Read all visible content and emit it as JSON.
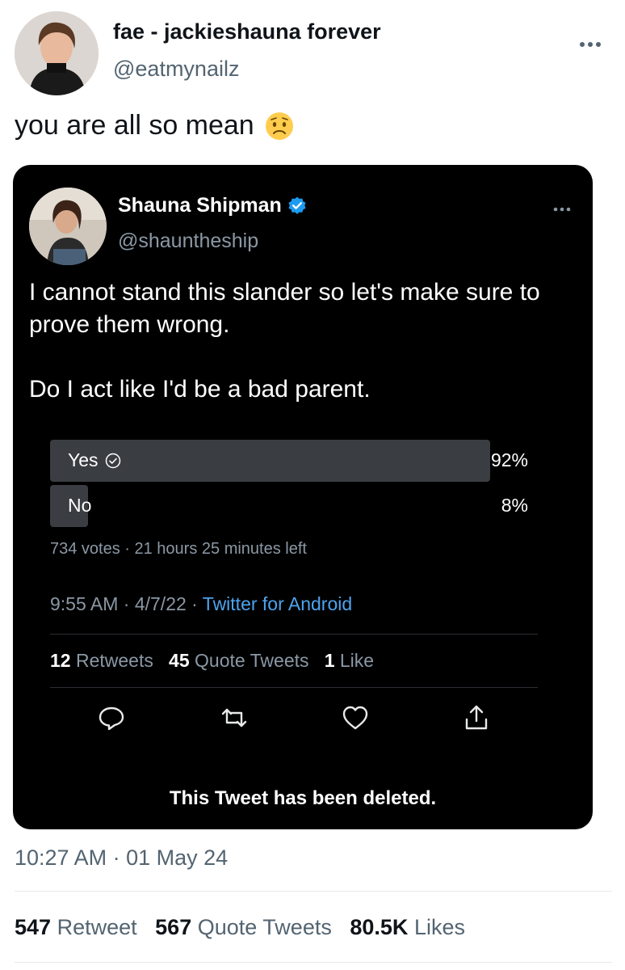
{
  "outer_tweet": {
    "display_name": "fae - jackieshauna forever",
    "handle": "@eatmynailz",
    "text": "you are all so mean",
    "emoji_icon": "worried-face-emoji",
    "timestamp": "10:27 AM · 01 May 24",
    "stats": {
      "retweets_count": "547",
      "retweets_label": "Retweet",
      "quote_count": "567",
      "quote_label": "Quote Tweets",
      "likes_count": "80.5K",
      "likes_label": "Likes"
    }
  },
  "embedded_tweet": {
    "display_name": "Shauna Shipman",
    "verified": true,
    "handle": "@shauntheship",
    "text_line1": "I cannot stand this slander so let's make sure to prove them wrong.",
    "text_line2": "Do I act like I'd be a bad parent.",
    "poll": {
      "options": [
        {
          "label": "Yes",
          "percent_label": "92%",
          "percent": 92,
          "selected": true
        },
        {
          "label": "No",
          "percent_label": "8%",
          "percent": 8,
          "selected": false
        }
      ],
      "meta": "734 votes · 21 hours 25 minutes left"
    },
    "time_prefix": "9:55 AM · 4/7/22 · ",
    "source": "Twitter for Android",
    "stats": {
      "retweets_count": "12",
      "retweets_label": "Retweets",
      "quote_count": "45",
      "quote_label": "Quote Tweets",
      "likes_count": "1",
      "likes_label": "Like"
    },
    "actions": [
      "reply-icon",
      "retweet-icon",
      "like-icon",
      "share-icon"
    ],
    "deleted_notice": "This Tweet has been deleted."
  },
  "colors": {
    "card_background": "#000000",
    "poll_bar": "#3a3d41",
    "link": "#4ea3ee",
    "verified": "#1d9bf0",
    "muted_dark": "#8b98a5",
    "muted_light": "#536471"
  }
}
